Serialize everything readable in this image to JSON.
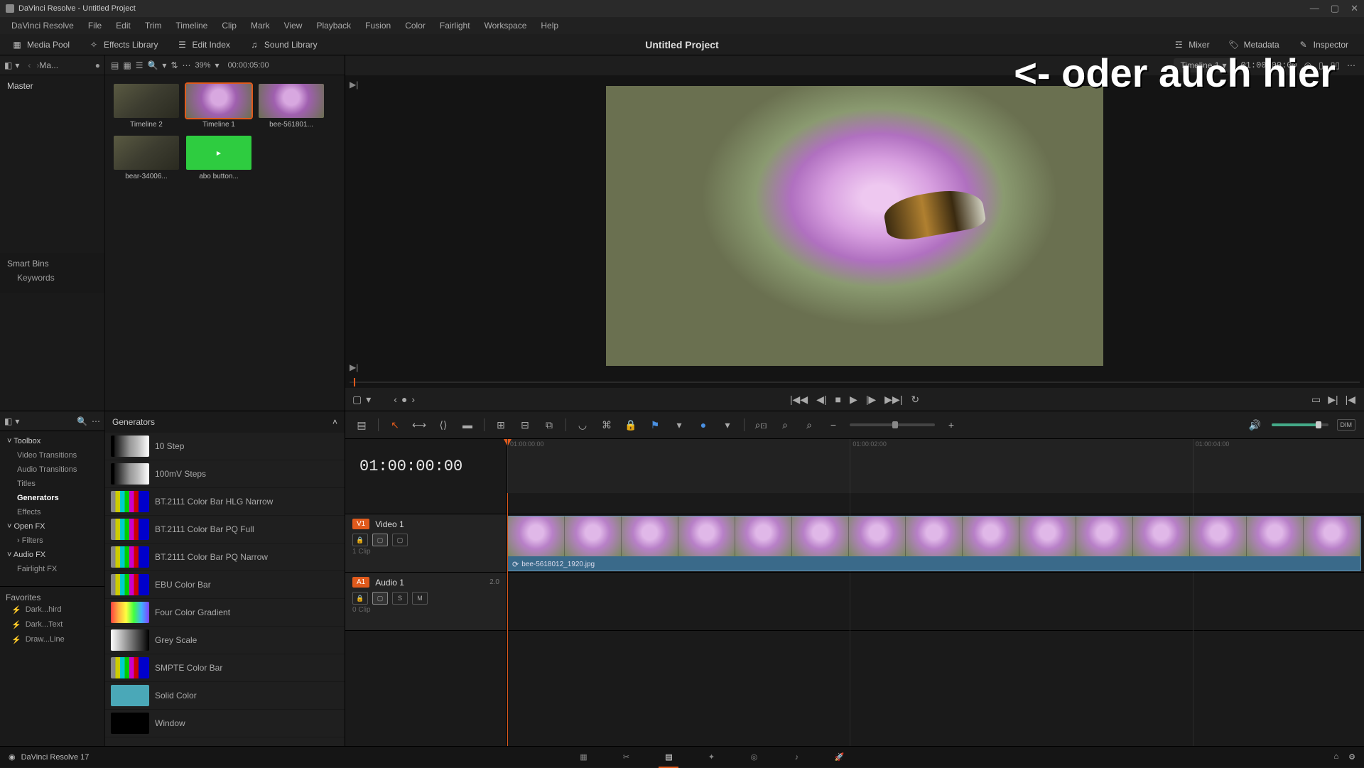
{
  "window": {
    "title": "DaVinci Resolve - Untitled Project"
  },
  "menubar": [
    "DaVinci Resolve",
    "File",
    "Edit",
    "Trim",
    "Timeline",
    "Clip",
    "Mark",
    "View",
    "Playback",
    "Fusion",
    "Color",
    "Fairlight",
    "Workspace",
    "Help"
  ],
  "subtoolbar": {
    "media_pool": "Media Pool",
    "effects_library": "Effects Library",
    "edit_index": "Edit Index",
    "sound_library": "Sound Library",
    "project_title": "Untitled Project",
    "mixer": "Mixer",
    "metadata": "Metadata",
    "inspector": "Inspector"
  },
  "media_pool": {
    "title": "Ma...",
    "master": "Master",
    "smart_bins": "Smart Bins",
    "keywords": "Keywords",
    "zoom": "39%",
    "timecode": "00:00:05:00",
    "clips": [
      {
        "label": "Timeline 2",
        "kind": "bear"
      },
      {
        "label": "Timeline 1",
        "kind": "flower",
        "selected": true
      },
      {
        "label": "bee-561801...",
        "kind": "flower"
      },
      {
        "label": "bear-34006...",
        "kind": "bear"
      },
      {
        "label": "abo button...",
        "kind": "green"
      }
    ]
  },
  "viewer": {
    "timeline_name": "Timeline 1",
    "right_tc": "01:00:00:00"
  },
  "annotation": "<- oder auch hier",
  "fx_tree": {
    "toolbox": "Toolbox",
    "items": [
      "Video Transitions",
      "Audio Transitions",
      "Titles",
      "Generators",
      "Effects"
    ],
    "selected": "Generators",
    "open_fx": "Open FX",
    "filters": "Filters",
    "audio_fx": "Audio FX",
    "fairlight_fx": "Fairlight FX",
    "favorites": "Favorites",
    "fav_items": [
      "Dark...hird",
      "Dark...Text",
      "Draw...Line"
    ]
  },
  "fx_list": {
    "header": "Generators",
    "rows": [
      {
        "name": "10 Step",
        "sw": "sw-step"
      },
      {
        "name": "100mV Steps",
        "sw": "sw-step"
      },
      {
        "name": "BT.2111 Color Bar HLG Narrow",
        "sw": "sw-bars"
      },
      {
        "name": "BT.2111 Color Bar PQ Full",
        "sw": "sw-bars"
      },
      {
        "name": "BT.2111 Color Bar PQ Narrow",
        "sw": "sw-bars"
      },
      {
        "name": "EBU Color Bar",
        "sw": "sw-bars"
      },
      {
        "name": "Four Color Gradient",
        "sw": "sw-grad"
      },
      {
        "name": "Grey Scale",
        "sw": "sw-grey"
      },
      {
        "name": "SMPTE Color Bar",
        "sw": "sw-bars"
      },
      {
        "name": "Solid Color",
        "sw": "sw-solid"
      },
      {
        "name": "Window",
        "sw": "sw-black"
      }
    ]
  },
  "timeline": {
    "big_tc": "01:00:00:00",
    "ruler_ticks": [
      "01:00:00:00",
      "01:00:02:00",
      "01:00:04:00"
    ],
    "video_track": {
      "badge": "V1",
      "name": "Video 1",
      "clipcount": "1 Clip"
    },
    "audio_track": {
      "badge": "A1",
      "name": "Audio 1",
      "clipcount": "0 Clip",
      "ch": "2.0"
    },
    "clip_name": "bee-5618012_1920.jpg",
    "dim_label": "DIM"
  },
  "pagebar": {
    "version": "DaVinci Resolve 17"
  }
}
